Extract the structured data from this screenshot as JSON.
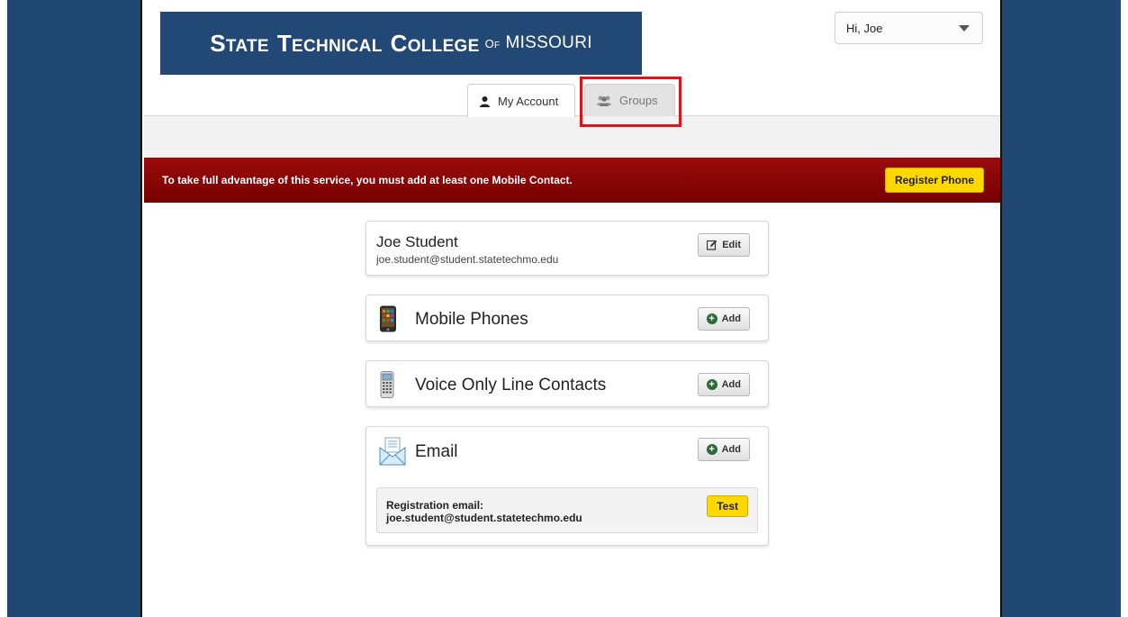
{
  "header": {
    "logo": {
      "state": "STATE",
      "technical": "TECHNICAL",
      "college": "COLLEGE",
      "of": "OF",
      "missouri": "MISSOURI"
    },
    "user_menu_label": "Hi, Joe"
  },
  "tabs": [
    {
      "label": "My Account",
      "active": true
    },
    {
      "label": "Groups",
      "active": false
    }
  ],
  "alert": {
    "message": "To take full advantage of this service, you must add at least one Mobile Contact.",
    "button_label": "Register Phone"
  },
  "profile": {
    "name": "Joe Student",
    "email": "joe.student@student.statetechmo.edu",
    "edit_label": "Edit"
  },
  "contacts": {
    "mobile": {
      "title": "Mobile Phones",
      "add_label": "Add",
      "icon": "mobile-phone-icon"
    },
    "voice": {
      "title": "Voice Only Line Contacts",
      "add_label": "Add",
      "icon": "landline-phone-icon"
    },
    "email": {
      "title": "Email",
      "add_label": "Add",
      "icon": "envelope-icon",
      "registration_label": "Registration email:",
      "registration_value": "joe.student@student.statetechmo.edu",
      "test_label": "Test"
    }
  },
  "colors": {
    "brand_blue": "#224975",
    "alert_red": "#8b0000",
    "button_yellow": "#ffd800",
    "highlight_red": "#e0121b"
  }
}
